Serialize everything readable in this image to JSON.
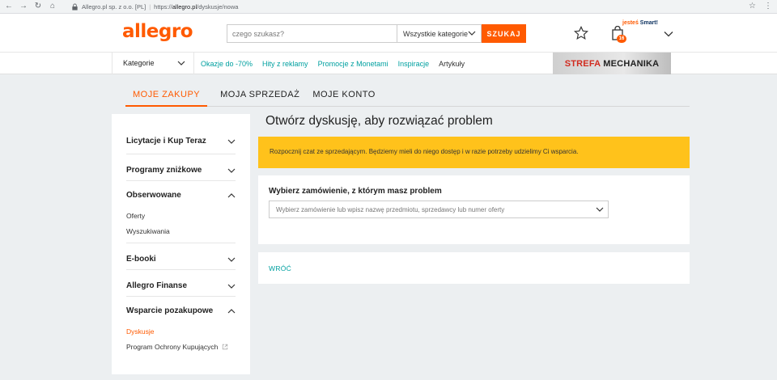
{
  "browser": {
    "site_name": "Allegro.pl sp. z o.o. [PL]",
    "url_prefix": "https://",
    "url_host": "allegro.pl",
    "url_path": "/dyskusje/nowa"
  },
  "header": {
    "logo": "allegro",
    "search_placeholder": "czego szukasz?",
    "category_select": "Wszystkie kategorie",
    "search_button": "SZUKAJ",
    "cart_count": "16",
    "smart_prefix": "jesteś ",
    "smart_brand": "Smart!"
  },
  "navbar": {
    "categories": "Kategorie",
    "links": [
      {
        "label": "Okazje do -70%",
        "style": "link"
      },
      {
        "label": "Hity z reklamy",
        "style": "link"
      },
      {
        "label": "Promocje z Monetami",
        "style": "link"
      },
      {
        "label": "Inspiracje",
        "style": "link"
      },
      {
        "label": "Artykuły",
        "style": "dark"
      }
    ],
    "promo_red": "STREFA",
    "promo_black": "MECHANIKA"
  },
  "tabs": [
    {
      "label": "MOJE ZAKUPY",
      "active": true
    },
    {
      "label": "MOJA SPRZEDAŻ",
      "active": false
    },
    {
      "label": "MOJE KONTO",
      "active": false
    }
  ],
  "sidebar": {
    "item_licytacje": "Licytacje i Kup Teraz",
    "item_programy": "Programy zniżkowe",
    "group_obserwowane": "Obserwowane",
    "sub_oferty": "Oferty",
    "sub_wyszukiwania": "Wyszukiwania",
    "item_ebooki": "E-booki",
    "item_finanse": "Allegro Finanse",
    "group_wsparcie": "Wsparcie pozakupowe",
    "sub_dyskusje": "Dyskusje",
    "sub_program": "Program Ochrony Kupujących"
  },
  "main": {
    "title": "Otwórz dyskusję, aby rozwiązać problem",
    "info": "Rozpocznij czat ze sprzedającym. Będziemy mieli do niego dostęp i w razie potrzeby udzielimy Ci wsparcia.",
    "order_label": "Wybierz zamówienie, z którym masz problem",
    "order_placeholder": "Wybierz zamówienie lub wpisz nazwę przedmiotu, sprzedawcy lub numer oferty",
    "back": "WRÓĆ"
  },
  "colors": {
    "accent": "#ff5a00",
    "link": "#00a0a0",
    "info_bg": "#ffc21b"
  }
}
